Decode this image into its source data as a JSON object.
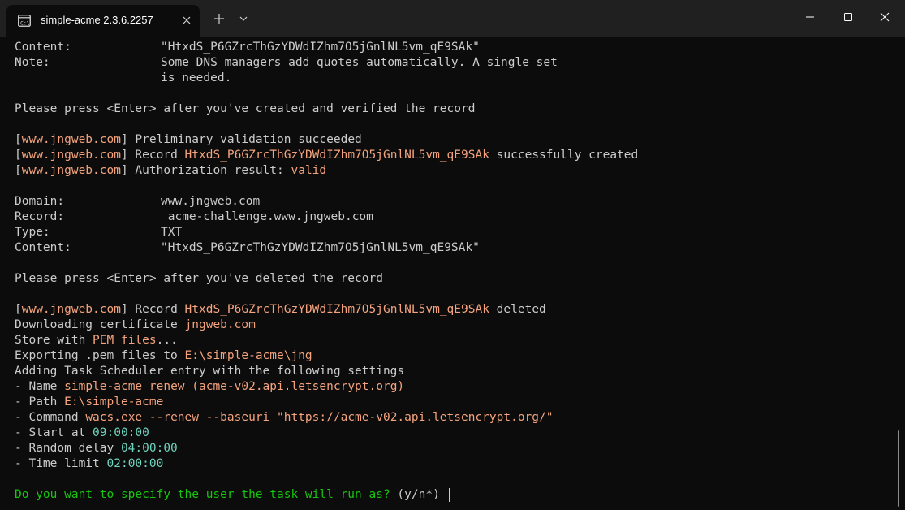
{
  "window": {
    "tab_title": "simple-acme 2.3.6.2257",
    "icons": [
      "terminal-icon",
      "close-icon",
      "plus-icon",
      "chevron-down-icon",
      "minimize-icon",
      "maximize-icon",
      "close-icon"
    ]
  },
  "terminal": {
    "colors": {
      "text": "#cccccc",
      "highlight": "#f4a37d",
      "success": "#6fd3be",
      "prompt": "#16c60c"
    },
    "block1": {
      "content_label": "Content:",
      "content_value": "\"HtxdS_P6GZrcThGzYDWdIZhm7O5jGnlNL5vm_qE9SAk\"",
      "note_label": "Note:",
      "note_line1": "Some DNS managers add quotes automatically. A single set",
      "note_line2": "is needed."
    },
    "press_created": "Please press <Enter> after you've created and verified the record",
    "validation": {
      "domain_tag": "www.jngweb.com",
      "preliminary": "Preliminary validation succeeded",
      "record_word": "Record",
      "token": "HtxdS_P6GZrcThGzYDWdIZhm7O5jGnlNL5vm_qE9SAk",
      "created": "successfully created",
      "auth_result": "Authorization result:",
      "valid": "valid"
    },
    "block2": {
      "domain_label": "Domain:",
      "domain_value": "www.jngweb.com",
      "record_label": "Record:",
      "record_value": "_acme-challenge.www.jngweb.com",
      "type_label": "Type:",
      "type_value": "TXT",
      "content_label": "Content:",
      "content_value": "\"HtxdS_P6GZrcThGzYDWdIZhm7O5jGnlNL5vm_qE9SAk\""
    },
    "press_deleted": "Please press <Enter> after you've deleted the record",
    "deleted": "deleted",
    "downloading": "Downloading certificate",
    "download_domain": "jngweb.com",
    "store_with": "Store with",
    "pem_files": "PEM files",
    "ellipsis": "...",
    "exporting": "Exporting .pem files to",
    "export_path": "E:\\simple-acme\\jng",
    "adding_task": "Adding Task Scheduler entry with the following settings",
    "task": {
      "name_label": "- Name",
      "name_value": "simple-acme renew (acme-v02.api.letsencrypt.org)",
      "path_label": "- Path",
      "path_value": "E:\\simple-acme",
      "command_label": "- Command",
      "command_value": "wacs.exe --renew --baseuri \"https://acme-v02.api.letsencrypt.org/\"",
      "start_label": "- Start at",
      "start_value": "09:00:00",
      "delay_label": "- Random delay",
      "delay_value": "04:00:00",
      "limit_label": "- Time limit",
      "limit_value": "02:00:00"
    },
    "question": "Do you want to specify the user the task will run as?",
    "question_options": "(y/n*)"
  }
}
